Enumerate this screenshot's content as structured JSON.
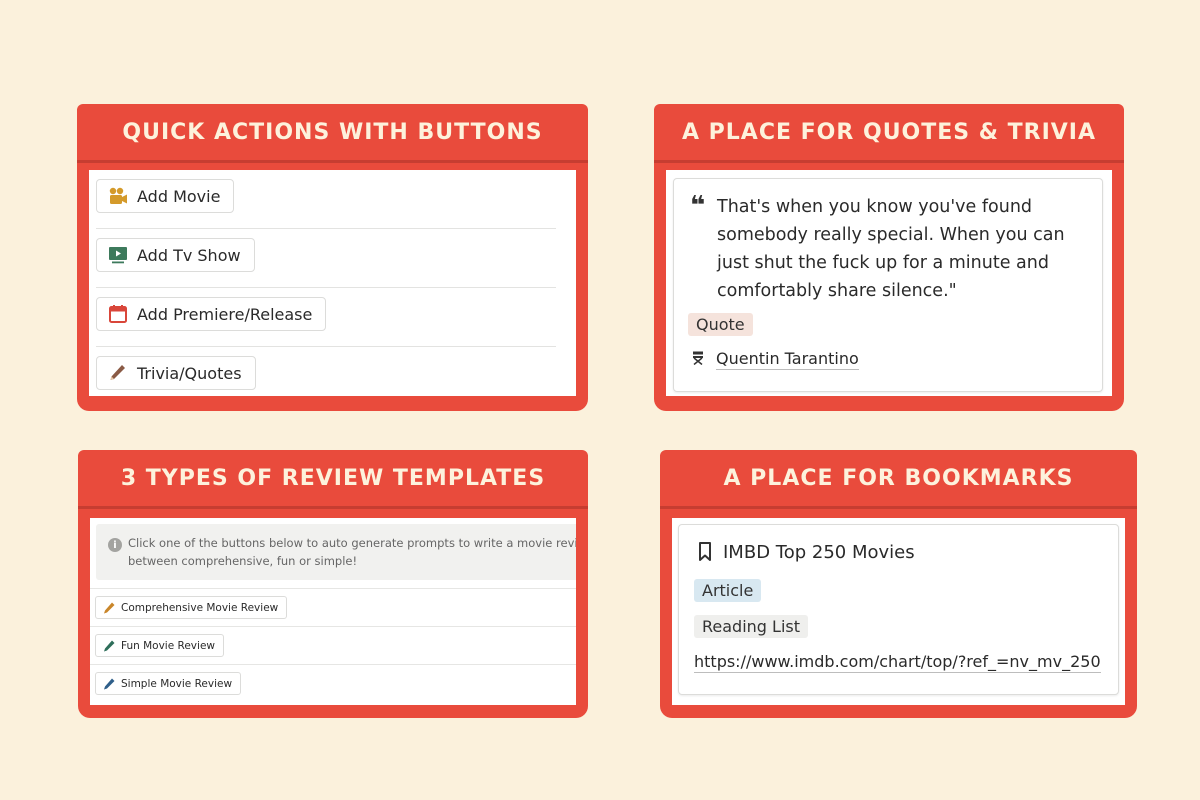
{
  "colors": {
    "accent": "#e94b3c",
    "background": "#fbf1dc",
    "header_text": "#fdf2dc"
  },
  "quick_actions": {
    "title": "QUICK ACTIONS WITH BUTTONS",
    "buttons": [
      {
        "label": "Add Movie",
        "icon": "movie-camera-icon"
      },
      {
        "label": "Add Tv Show",
        "icon": "tv-play-icon"
      },
      {
        "label": "Add Premiere/Release",
        "icon": "calendar-icon"
      },
      {
        "label": "Trivia/Quotes",
        "icon": "pencil-icon"
      }
    ]
  },
  "quotes": {
    "title": "A PLACE FOR QUOTES & TRIVIA",
    "quote_mark": "❝",
    "text": "That's when you know you've found somebody really special. When you can just shut the fuck up for a minute and comfortably share silence.\"",
    "tag": "Quote",
    "author": "Quentin Tarantino",
    "author_icon": "director-chair-icon"
  },
  "review": {
    "title": "3 TYPES OF REVIEW TEMPLATES",
    "callout_line1": "Click one of the buttons below to auto generate prompts to write a movie review. Choose",
    "callout_line2": "between comprehensive, fun or simple!",
    "buttons": [
      {
        "label": "Comprehensive Movie Review",
        "icon": "pencil-icon"
      },
      {
        "label": "Fun Movie Review",
        "icon": "pencil-icon"
      },
      {
        "label": "Simple Movie Review",
        "icon": "pencil-icon"
      }
    ]
  },
  "bookmarks": {
    "title": "A PLACE FOR BOOKMARKS",
    "item_title": "IMBD Top 250 Movies",
    "item_icon": "bookmark-icon",
    "tag1": "Article",
    "tag2": "Reading List",
    "url": "https://www.imdb.com/chart/top/?ref_=nv_mv_250"
  }
}
